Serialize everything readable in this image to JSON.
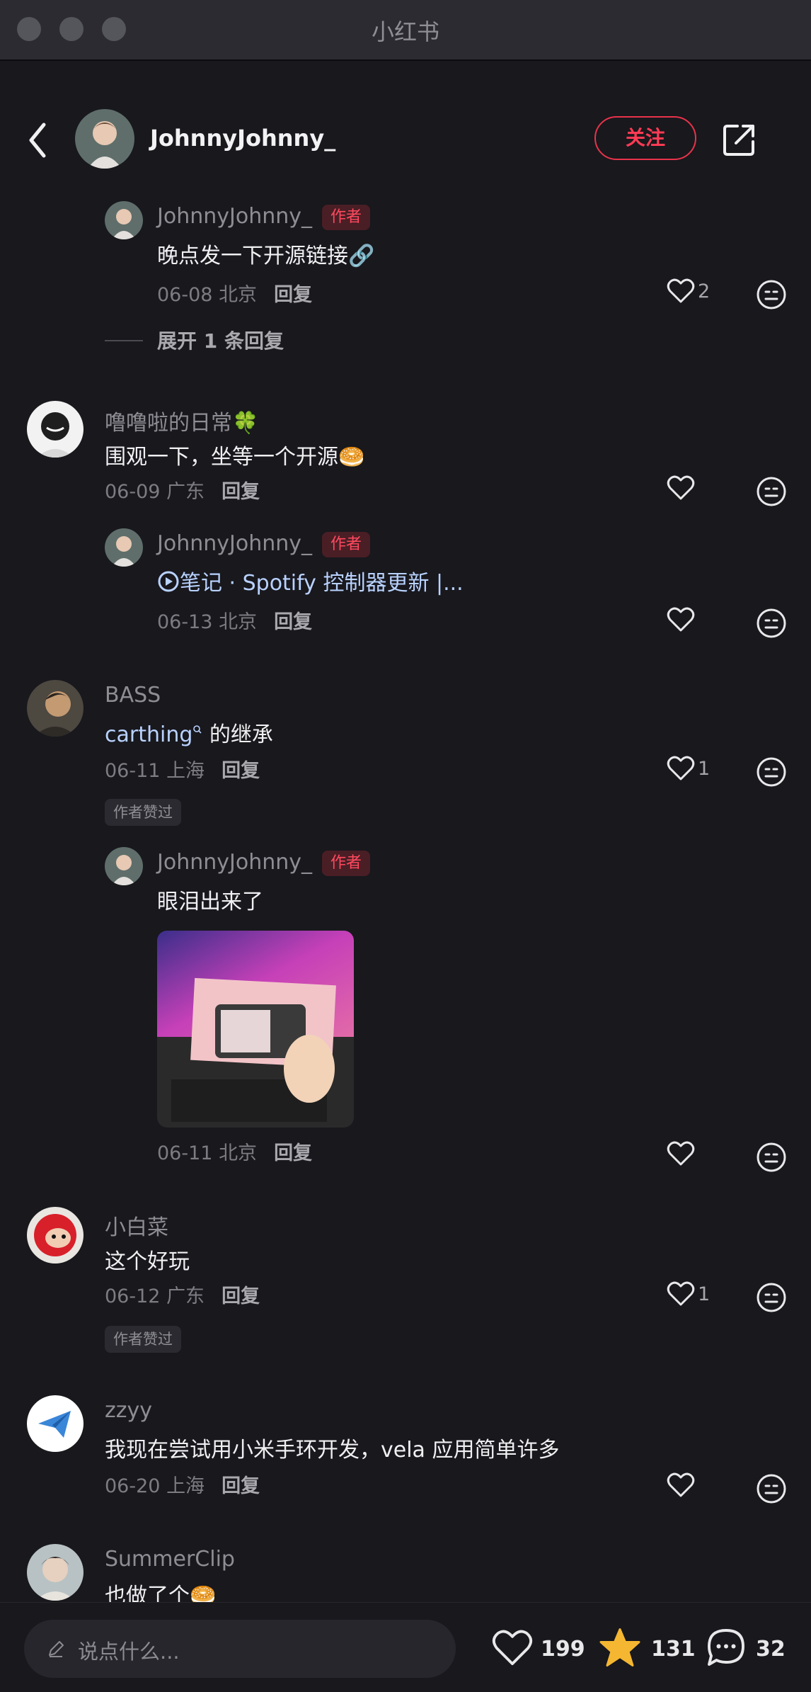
{
  "window": {
    "title": "小红书"
  },
  "header": {
    "author_name": "JohnnyJohnny_",
    "follow_label": "关注"
  },
  "author_tag": "作者",
  "liked_by_author_tag": "作者赞过",
  "reply_label": "回复",
  "comments": [
    {
      "name": "JohnnyJohnny_",
      "text": "晚点发一下开源链接🔗",
      "date": "06-08",
      "location": "北京",
      "likes": "2"
    },
    {
      "name": "噜噜啦的日常🍀",
      "text": "围观一下，坐等一个开源🥯",
      "date": "06-09",
      "location": "广东",
      "likes": ""
    },
    {
      "name": "JohnnyJohnny_",
      "text_link": "笔记 · Spotify 控制器更新 |...",
      "date": "06-13",
      "location": "北京",
      "likes": ""
    },
    {
      "name": "BASS",
      "text_keyword": "carthing",
      "text_rest": " 的继承",
      "date": "06-11",
      "location": "上海",
      "likes": "1"
    },
    {
      "name": "JohnnyJohnny_",
      "text": "眼泪出来了",
      "date": "06-11",
      "location": "北京",
      "likes": ""
    },
    {
      "name": "小白菜",
      "text": "这个好玩",
      "date": "06-12",
      "location": "广东",
      "likes": "1"
    },
    {
      "name": "zzyy",
      "text": "我现在尝试用小米手环开发，vela 应用简单许多",
      "date": "06-20",
      "location": "上海",
      "likes": ""
    },
    {
      "name": "SummerClip",
      "text": "也做了个🥯"
    }
  ],
  "expand_replies": "展开 1 条回复",
  "bottom": {
    "input_placeholder": "说点什么...",
    "likes": "199",
    "collects": "131",
    "comments": "32"
  },
  "colors": {
    "accent": "#ff3b54",
    "background": "#18181d",
    "star": "#f5b731",
    "link": "#b9d2ff"
  }
}
